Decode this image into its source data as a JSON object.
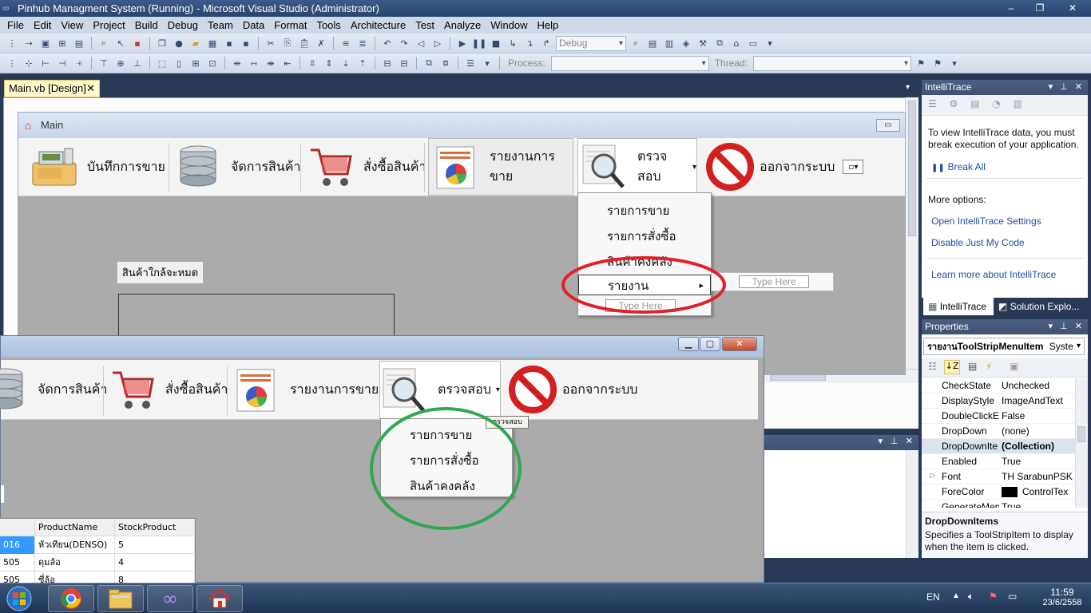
{
  "window": {
    "title": "Pinhub Managment System (Running) - Microsoft Visual Studio (Administrator)",
    "controls": [
      "–",
      "❐",
      "✕"
    ]
  },
  "menu": [
    "File",
    "Edit",
    "View",
    "Project",
    "Build",
    "Debug",
    "Team",
    "Data",
    "Format",
    "Tools",
    "Architecture",
    "Test",
    "Analyze",
    "Window",
    "Help"
  ],
  "toolbar": {
    "config_value": "Debug",
    "process_label": "Process:",
    "thread_label": "Thread:"
  },
  "document_tab": {
    "label": "Main.vb [Design]",
    "close": "✕"
  },
  "design_form": {
    "title": "Main",
    "min_button": "▭",
    "toolstrip": [
      {
        "label": "บันทึกการขาย",
        "icon": "cash-register-icon"
      },
      {
        "label": "จัดการสินค้า",
        "icon": "database-icon"
      },
      {
        "label": "สั่งซื้อสินค้า",
        "icon": "shopping-cart-icon"
      },
      {
        "label": "รายงานการขาย",
        "icon": "report-chart-icon"
      },
      {
        "label": "ตรวจสอบ",
        "icon": "magnifier-icon",
        "arrow": "▾"
      },
      {
        "label": "ออกจากระบบ",
        "icon": "logout-no-icon"
      }
    ],
    "label_low_stock": "สินค้าใกล้จะหมด",
    "dropdown_items": [
      "รายการขาย",
      "รายการสั่งซื้อ",
      "สินค้าคงคลัง",
      "รายงาน"
    ],
    "submenu_arrow": "▸",
    "type_here": "Type Here",
    "type_here_sub": "Type Here"
  },
  "running_form": {
    "controls": [
      "▁",
      "▢",
      "✕"
    ],
    "toolstrip": [
      {
        "label": "จัดการสินค้า",
        "icon": "database-icon"
      },
      {
        "label": "สั่งซื้อสินค้า",
        "icon": "shopping-cart-icon"
      },
      {
        "label": "รายงานการขาย",
        "icon": "report-chart-icon"
      },
      {
        "label": "ตรวจสอบ",
        "icon": "magnifier-icon",
        "arrow": "▾"
      },
      {
        "label": "ออกจากระบบ",
        "icon": "logout-no-icon"
      }
    ],
    "dropdown_items": [
      "รายการขาย",
      "รายการสั่งซื้อ",
      "สินค้าคงคลัง"
    ],
    "tooltip": "ตรวจสอบ",
    "grid": {
      "columns": [
        "",
        "ProductName",
        "StockProduct"
      ],
      "rows": [
        [
          "016",
          "หัวเทียน(DENSO)",
          "5"
        ],
        [
          "505",
          "ดุมล้อ",
          "4"
        ],
        [
          "505",
          "ซี่ล้อ",
          "8"
        ]
      ]
    }
  },
  "intellitrace": {
    "title": "IntelliTrace",
    "message": "To view IntelliTrace data, you must break execution of your application.",
    "break_all": "Break All",
    "more_options": "More options:",
    "links": [
      "Open IntelliTrace Settings",
      "Disable Just My Code"
    ],
    "learn_more": "Learn more about IntelliTrace",
    "tabs": [
      "IntelliTrace",
      "Solution Explo..."
    ]
  },
  "properties": {
    "title": "Properties",
    "object_name": "รายงาน",
    "object_type": "ToolStripMenuItem",
    "object_ns": "Syste",
    "rows": [
      {
        "name": "CheckState",
        "value": "Unchecked"
      },
      {
        "name": "DisplayStyle",
        "value": "ImageAndText"
      },
      {
        "name": "DoubleClickE",
        "value": "False"
      },
      {
        "name": "DropDown",
        "value": "(none)"
      },
      {
        "name": "DropDownIte",
        "value": "(Collection)"
      },
      {
        "name": "Enabled",
        "value": "True"
      },
      {
        "name": "Font",
        "value": "TH SarabunPSK,"
      },
      {
        "name": "ForeColor",
        "value": "ControlTex"
      },
      {
        "name": "GenerateMen",
        "value": "True"
      }
    ],
    "desc_title": "DropDownItems",
    "desc_text": "Specifies a ToolStripItem to display when the item is clicked."
  },
  "taskbar": {
    "apps": [
      "windows-start-icon",
      "chrome-icon",
      "explorer-icon",
      "visual-studio-icon",
      "home-app-icon"
    ],
    "lang": "EN",
    "time": "11:59",
    "date": "23/6/2558"
  },
  "colors": {
    "annotation_red": "#e0202a",
    "annotation_green": "#2fa84f",
    "vs_dark": "#293955"
  }
}
